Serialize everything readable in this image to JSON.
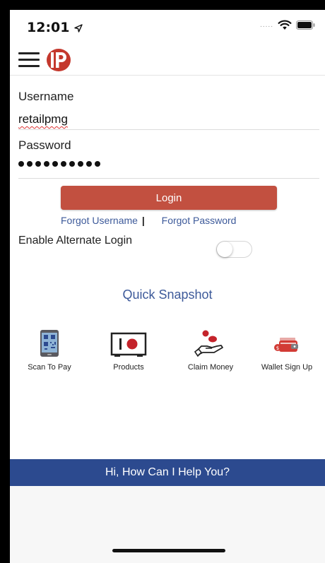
{
  "status_bar": {
    "time": "12:01",
    "signal": "....."
  },
  "form": {
    "username_label": "Username",
    "username_value": "retailpmg",
    "password_label": "Password",
    "login_label": "Login",
    "forgot_username": "Forgot Username",
    "forgot_separator": "|",
    "forgot_password": "Forgot Password",
    "alternate_login_label": "Enable Alternate Login"
  },
  "quick_snapshot": {
    "title": "Quick Snapshot",
    "items": [
      {
        "label": "Scan To Pay",
        "icon": "phone-qr-icon"
      },
      {
        "label": "Products",
        "icon": "safe-icon"
      },
      {
        "label": "Claim Money",
        "icon": "hand-coins-icon"
      },
      {
        "label": "Wallet Sign Up",
        "icon": "wallet-icon"
      }
    ]
  },
  "help_bar": {
    "label": "Hi, How Can I Help You?"
  },
  "colors": {
    "accent_red": "#c25040",
    "link_blue": "#3d5a9a",
    "help_bar_blue": "#2c4a8f"
  }
}
